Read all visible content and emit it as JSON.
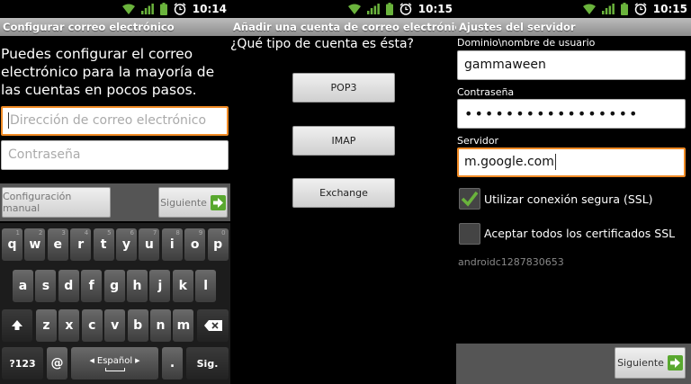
{
  "colors": {
    "focus": "#f08a24",
    "arrow_green": "#59a82f",
    "title_bar": "#a5a5a5",
    "check_green": "#6ab33c"
  },
  "panel1": {
    "time": "10:14",
    "title": "Configurar correo electrónico",
    "intro": "Puedes configurar el correo electrónico para la mayoría de las cuentas en pocos pasos.",
    "email_placeholder": "Dirección de correo electrónico",
    "password_placeholder": "Contraseña",
    "manual_button": "Configuración manual",
    "next_button": "Siguiente",
    "keyboard": {
      "row1": [
        {
          "key": "q",
          "hint": "1"
        },
        {
          "key": "w",
          "hint": "2"
        },
        {
          "key": "e",
          "hint": "3"
        },
        {
          "key": "r",
          "hint": "4"
        },
        {
          "key": "t",
          "hint": "5"
        },
        {
          "key": "y",
          "hint": "6"
        },
        {
          "key": "u",
          "hint": "7"
        },
        {
          "key": "i",
          "hint": "8"
        },
        {
          "key": "o",
          "hint": "9"
        },
        {
          "key": "p",
          "hint": "0"
        }
      ],
      "row2": [
        "a",
        "s",
        "d",
        "f",
        "g",
        "h",
        "j",
        "k",
        "l"
      ],
      "row3": [
        "z",
        "x",
        "c",
        "v",
        "b",
        "n",
        "m"
      ],
      "symbols_key": "?123",
      "at_key": "@",
      "space_key": "Español",
      "period_key": ".",
      "next_key": "Sig."
    }
  },
  "panel2": {
    "time": "10:15",
    "title": "Añadir una cuenta de correo electrónico nue...",
    "question": "¿Qué tipo de cuenta es ésta?",
    "buttons": [
      "POP3",
      "IMAP",
      "Exchange"
    ]
  },
  "panel3": {
    "time": "10:15",
    "title": "Ajustes del servidor",
    "username_label": "Dominio\\nombre de usuario",
    "username_value": "gammaween",
    "password_label": "Contraseña",
    "password_value": "•••••••••••••••••",
    "server_label": "Servidor",
    "server_value": "m.google.com",
    "ssl_label": "Utilizar conexión segura (SSL)",
    "ssl_checked": true,
    "accept_label": "Aceptar todos los certificados SSL",
    "accept_checked": false,
    "device_id": "androidc1287830653",
    "next_button": "Siguiente"
  }
}
